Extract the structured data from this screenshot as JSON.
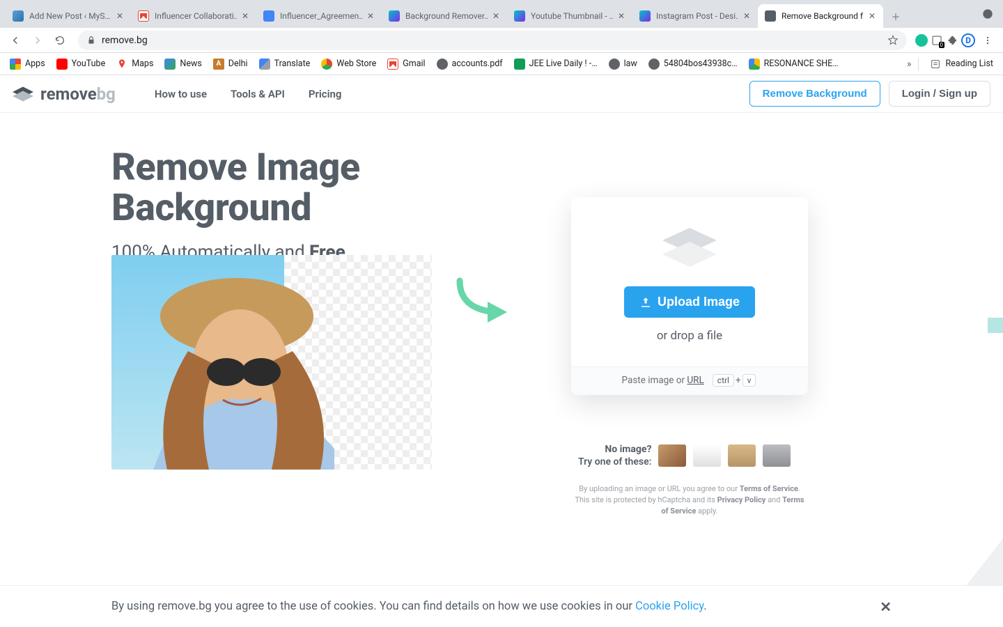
{
  "browser": {
    "tabs": [
      {
        "title": "Add New Post ‹ MyS…"
      },
      {
        "title": "Influencer Collaborati…"
      },
      {
        "title": "Influencer_Agreemen…"
      },
      {
        "title": "Background Remover…"
      },
      {
        "title": "Youtube Thumbnail - …"
      },
      {
        "title": "Instagram Post - Desi…"
      },
      {
        "title": "Remove Background f…"
      }
    ],
    "url": "remove.bg",
    "extension_badge": "0"
  },
  "bookmarks": [
    {
      "label": "Apps"
    },
    {
      "label": "YouTube"
    },
    {
      "label": "Maps"
    },
    {
      "label": "News"
    },
    {
      "label": "Delhi"
    },
    {
      "label": "Translate"
    },
    {
      "label": "Web Store"
    },
    {
      "label": "Gmail"
    },
    {
      "label": "accounts.pdf"
    },
    {
      "label": "JEE Live Daily ! -…"
    },
    {
      "label": "law"
    },
    {
      "label": "54804bos43938c…"
    },
    {
      "label": "RESONANCE SHE…"
    }
  ],
  "bookmarks_right": {
    "overflow": "»",
    "reading_list": "Reading List"
  },
  "site": {
    "logo": {
      "pre": "remove",
      "suf": "bg"
    },
    "nav": {
      "how": "How to use",
      "tools": "Tools & API",
      "pricing": "Pricing"
    },
    "actions": {
      "remove": "Remove Background",
      "login": "Login / Sign up"
    }
  },
  "hero": {
    "h1_a": "Remove Image",
    "h1_b": "Background",
    "sub_a": "100% Automatically and ",
    "sub_free": "Free"
  },
  "upload": {
    "button": "Upload Image",
    "hint": "or drop a file",
    "footer_pre": "Paste image or ",
    "footer_url": "URL",
    "kbd1": "ctrl",
    "kbd_plus": "+",
    "kbd2": "v"
  },
  "samples": {
    "line1": "No image?",
    "line2": "Try one of these:"
  },
  "legal": {
    "a": "By uploading an image or URL you agree to our ",
    "tos": "Terms of Service",
    "b": ". This site is protected by hCaptcha and its ",
    "pp": "Privacy Policy",
    "c": " and ",
    "tos2": "Terms of Service",
    "d": " apply."
  },
  "cookie": {
    "text": "By using remove.bg you agree to the use of cookies. You can find details on how we use cookies in our ",
    "link": "Cookie Policy",
    "dot": "."
  }
}
